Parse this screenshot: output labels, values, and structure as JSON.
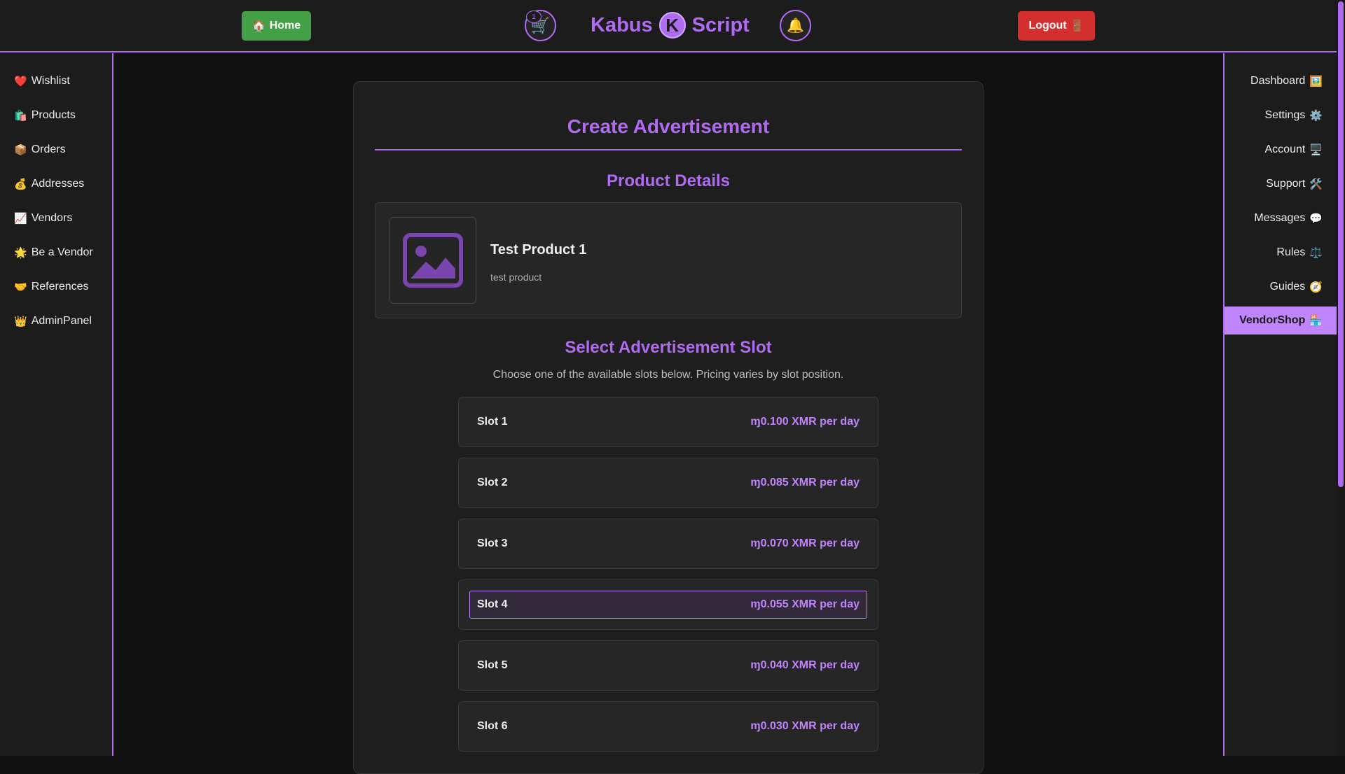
{
  "header": {
    "home_icon": "🏠",
    "home_label": "Home",
    "cart_icon": "🛒",
    "cart_count": "1",
    "brand_left": "Kabus",
    "brand_logo_letter": "K",
    "brand_right": "Script",
    "bell_icon": "🔔",
    "logout_label": "Logout",
    "logout_icon": "🚪"
  },
  "left_sidebar": {
    "items": [
      {
        "icon": "❤️",
        "label": "Wishlist"
      },
      {
        "icon": "🛍️",
        "label": "Products"
      },
      {
        "icon": "📦",
        "label": "Orders"
      },
      {
        "icon": "💰",
        "label": "Addresses"
      },
      {
        "icon": "📈",
        "label": "Vendors"
      },
      {
        "icon": "🌟",
        "label": "Be a Vendor"
      },
      {
        "icon": "🤝",
        "label": "References"
      },
      {
        "icon": "👑",
        "label": "AdminPanel"
      }
    ]
  },
  "right_sidebar": {
    "items": [
      {
        "label": "Dashboard",
        "icon": "🖼️"
      },
      {
        "label": "Settings",
        "icon": "⚙️"
      },
      {
        "label": "Account",
        "icon": "🖥️"
      },
      {
        "label": "Support",
        "icon": "🛠️"
      },
      {
        "label": "Messages",
        "icon": "💬"
      },
      {
        "label": "Rules",
        "icon": "⚖️"
      },
      {
        "label": "Guides",
        "icon": "🧭"
      },
      {
        "label": "VendorShop",
        "icon": "🏪",
        "active": true
      }
    ]
  },
  "main": {
    "title": "Create Advertisement",
    "product_section_title": "Product Details",
    "product": {
      "name": "Test Product 1",
      "description": "test product",
      "image_icon": "image-placeholder-icon"
    },
    "slot_section_title": "Select Advertisement Slot",
    "slot_hint": "Choose one of the available slots below. Pricing varies by slot position.",
    "slots": [
      {
        "name": "Slot 1",
        "price": "ɱ0.100 XMR per day"
      },
      {
        "name": "Slot 2",
        "price": "ɱ0.085 XMR per day"
      },
      {
        "name": "Slot 3",
        "price": "ɱ0.070 XMR per day"
      },
      {
        "name": "Slot 4",
        "price": "ɱ0.055 XMR per day",
        "selected": true
      },
      {
        "name": "Slot 5",
        "price": "ɱ0.040 XMR per day"
      },
      {
        "name": "Slot 6",
        "price": "ɱ0.030 XMR per day"
      }
    ]
  },
  "colors": {
    "accent": "#b06cf0",
    "home_button": "#43a047",
    "logout_button": "#d32f2f",
    "active_nav": "#c084fc"
  }
}
